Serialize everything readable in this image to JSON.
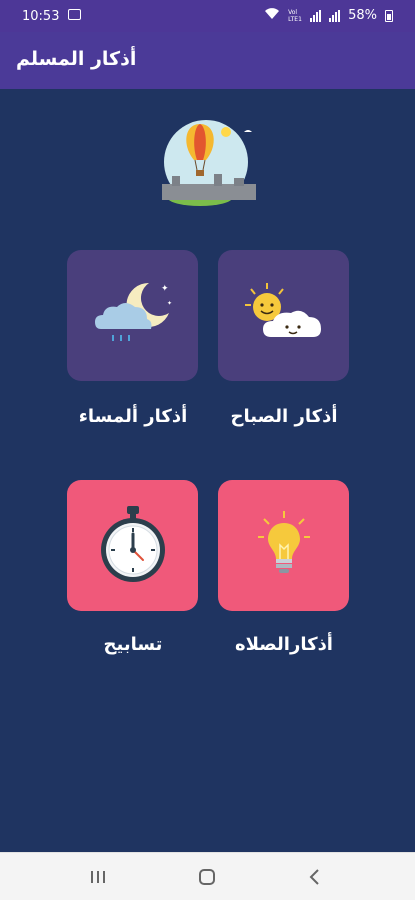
{
  "status_bar": {
    "time": "10:53",
    "network_label": "Vol LTE1",
    "battery": "58%"
  },
  "app_bar": {
    "title": "أذكار المسلم"
  },
  "menu": {
    "items": [
      {
        "label": "أذكار الصباح",
        "icon": "sun-cloud-icon",
        "color": "#4a3f7c"
      },
      {
        "label": "أذكار ألمساء",
        "icon": "moon-cloud-icon",
        "color": "#4a3f7c"
      },
      {
        "label": "أذكارالصلاه",
        "icon": "lightbulb-icon",
        "color": "#f0597a"
      },
      {
        "label": "تسابيح",
        "icon": "stopwatch-icon",
        "color": "#f0597a"
      }
    ]
  },
  "nav_bar": {
    "buttons": [
      "recent-apps-icon",
      "home-icon",
      "back-icon"
    ]
  },
  "colors": {
    "background": "#1f3461",
    "app_bar": "#4b3a98",
    "card_night": "#4a3f7c",
    "card_pink": "#f0597a"
  }
}
